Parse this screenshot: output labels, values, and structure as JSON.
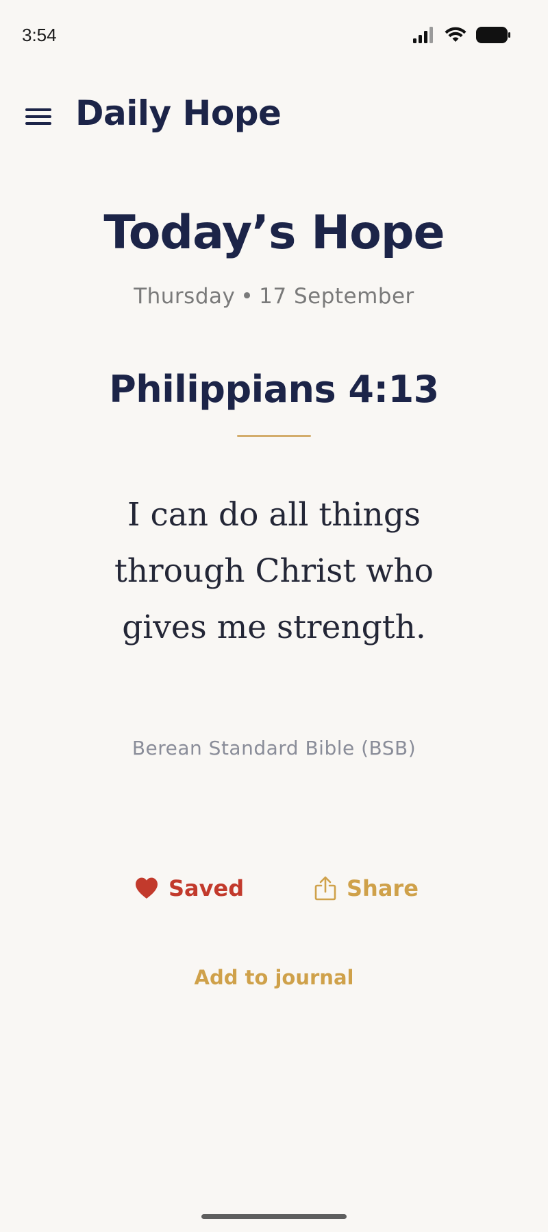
{
  "status_bar": {
    "time": "3:54"
  },
  "header": {
    "menu_icon": "hamburger-menu-icon",
    "app_title": "Daily Hope"
  },
  "main": {
    "page_title": "Today’s Hope",
    "date": {
      "day": "Thursday",
      "separator": "•",
      "date": "17 September"
    },
    "verse_reference": "Philippians 4:13",
    "verse_text": "I can do all things through Christ who gives me strength.",
    "translation": "Berean Standard Bible (BSB)"
  },
  "actions": {
    "saved_label": "Saved",
    "saved_icon": "heart-filled-icon",
    "share_label": "Share",
    "share_icon": "share-icon",
    "journal_label": "Add to journal"
  },
  "colors": {
    "background": "#f9f7f4",
    "navy": "#1c2448",
    "gold": "#cfa14a",
    "red": "#c23a2c",
    "muted": "#8a8d99"
  }
}
